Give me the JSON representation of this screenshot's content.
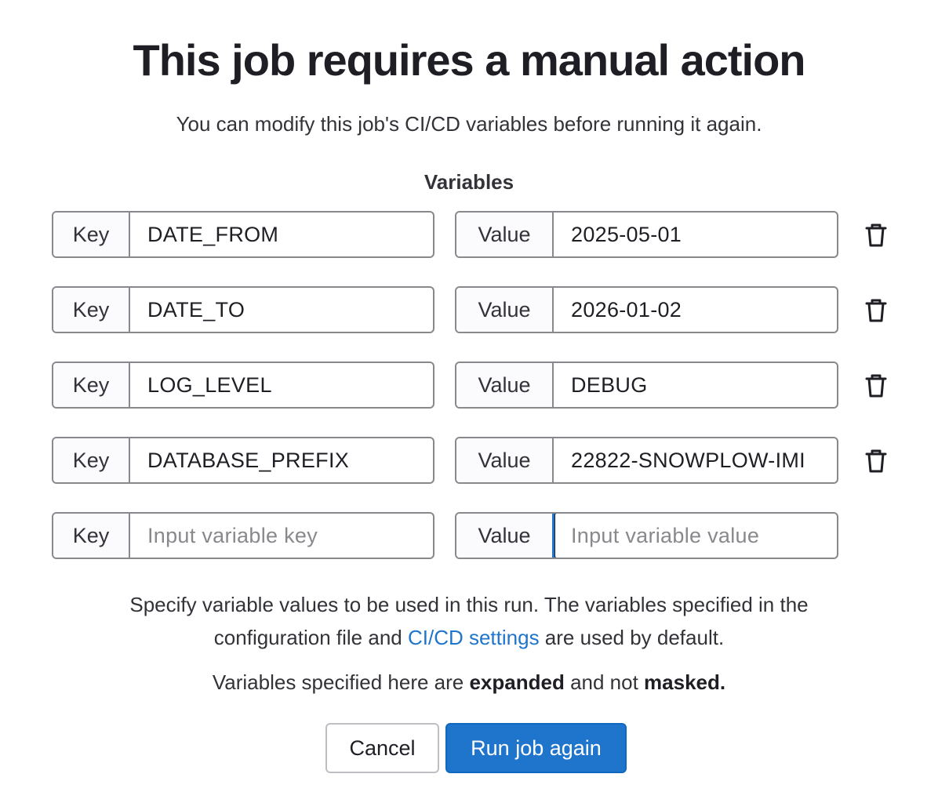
{
  "title": "This job requires a manual action",
  "subtitle": "You can modify this job's CI/CD variables before running it again.",
  "variables_heading": "Variables",
  "key_label": "Key",
  "value_label": "Value",
  "variables": [
    {
      "key": "DATE_FROM",
      "value": "2025-05-01"
    },
    {
      "key": "DATE_TO",
      "value": "2026-01-02"
    },
    {
      "key": "LOG_LEVEL",
      "value": "DEBUG"
    },
    {
      "key": "DATABASE_PREFIX",
      "value": "22822-SNOWPLOW-IMI"
    }
  ],
  "new_variable": {
    "key_placeholder": "Input variable key",
    "value_placeholder": "Input variable value"
  },
  "help": {
    "line1": "Specify variable values to be used in this run. The variables specified in the",
    "line2_before": "configuration file and ",
    "link_text": "CI/CD settings",
    "line2_after": " are used by default."
  },
  "note": {
    "before": "Variables specified here are ",
    "bold1": "expanded",
    "middle": " and not ",
    "bold2": "masked."
  },
  "buttons": {
    "cancel": "Cancel",
    "run": "Run job again"
  },
  "colors": {
    "primary": "#1f75cb",
    "border": "#89888d",
    "text": "#1f1e24"
  },
  "icons": {
    "delete": "trash-icon"
  }
}
